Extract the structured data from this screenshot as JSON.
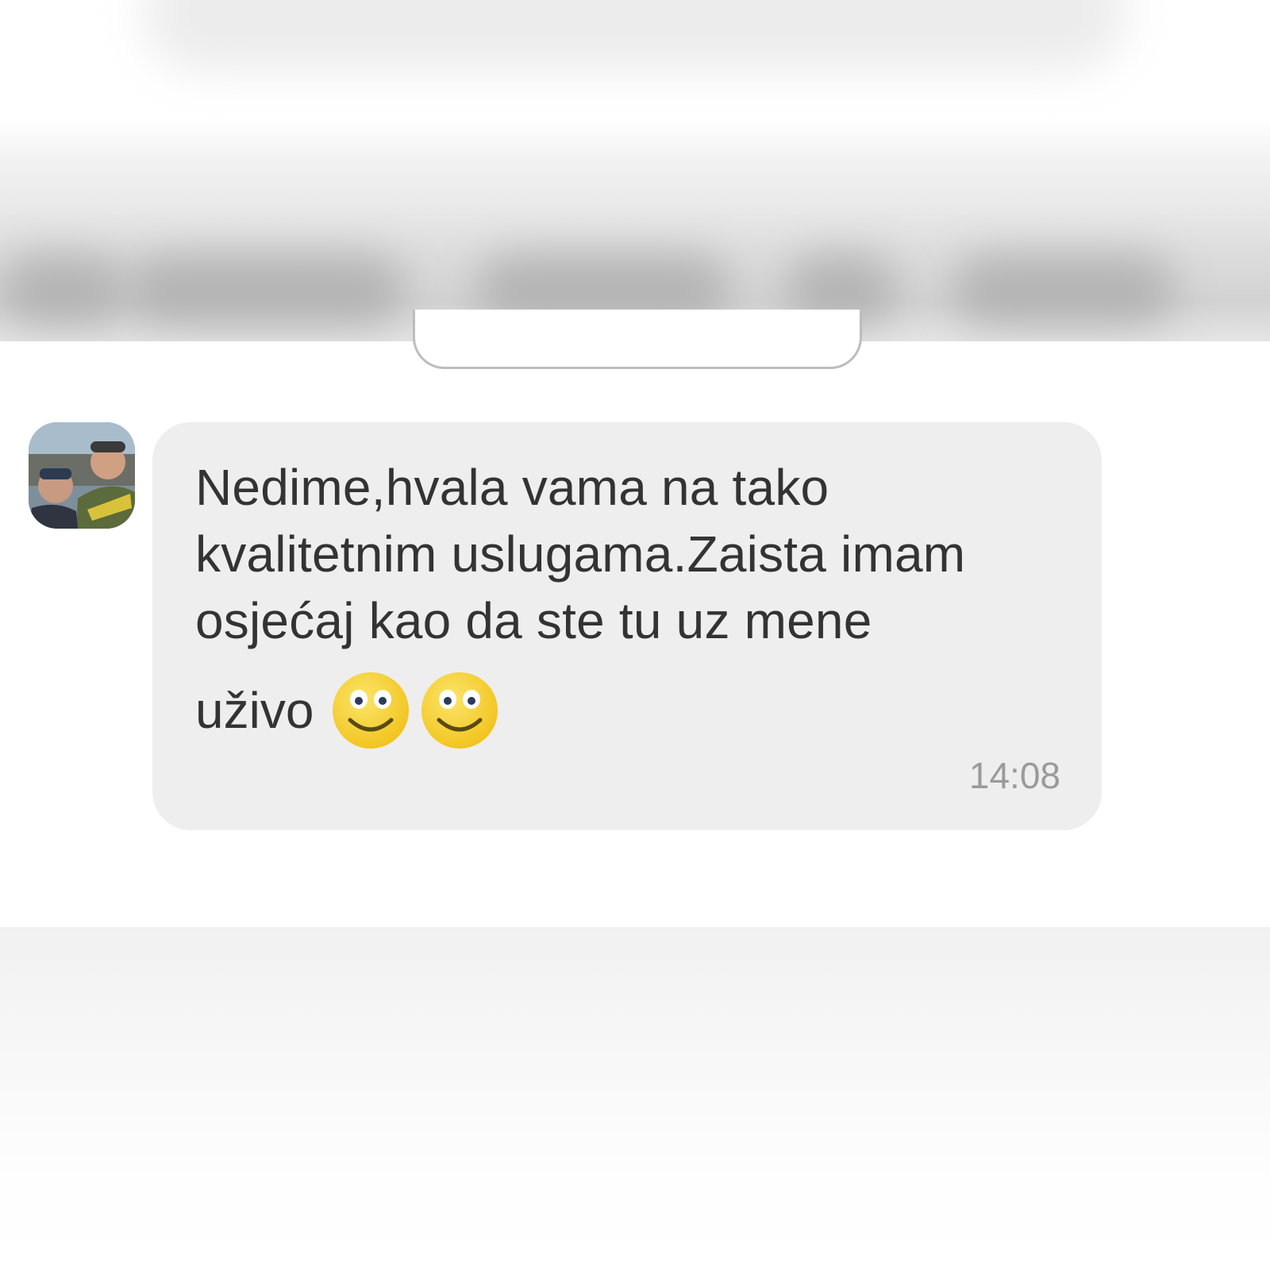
{
  "chat": {
    "message": {
      "lines": [
        "Nedime,hvala vama na tako",
        "kvalitetnim uslugama.Zaista imam",
        "osjećaj kao da ste tu uz mene"
      ],
      "last_line_text": "uživo",
      "emojis": [
        "smiley-emoji",
        "smiley-emoji"
      ],
      "time": "14:08"
    },
    "avatar_icon": "user-photo-avatar"
  },
  "colors": {
    "bubble": "#eeeeee",
    "text": "#333333",
    "time": "#9a9a9a",
    "emoji_face": "#f7d23c"
  }
}
